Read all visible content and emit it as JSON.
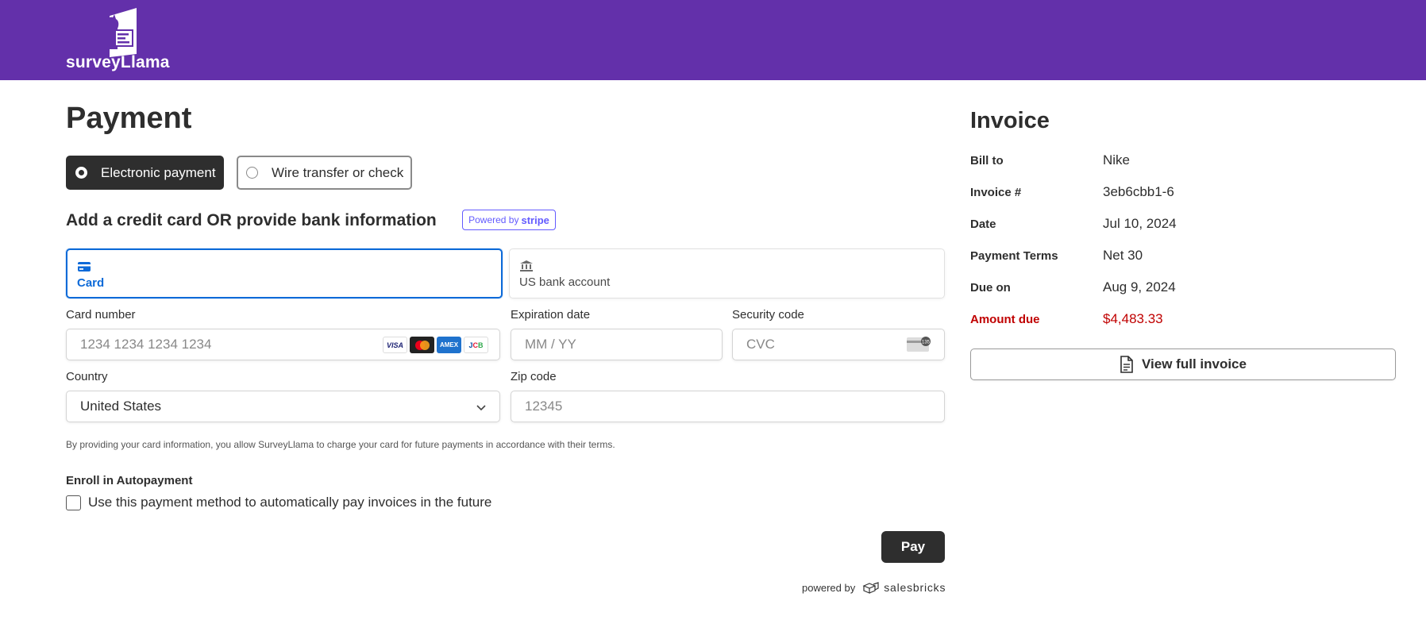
{
  "header": {
    "logo_text": "surveyLlama",
    "background": "#6330aa"
  },
  "payment": {
    "title": "Payment",
    "methods": {
      "electronic": "Electronic payment",
      "wire": "Wire transfer or check",
      "selected": "Electronic payment"
    },
    "section_title": "Add a credit card OR provide bank information",
    "stripe_badge": {
      "prefix": "Powered by",
      "brand": "stripe"
    },
    "tabs": {
      "card": "Card",
      "bank": "US bank account",
      "selected": "Card"
    },
    "form": {
      "card_number_label": "Card number",
      "card_number_placeholder": "1234 1234 1234 1234",
      "card_brands": [
        "VISA",
        "Mastercard",
        "AMEX",
        "JCB"
      ],
      "expiration_label": "Expiration date",
      "expiration_placeholder": "MM / YY",
      "security_label": "Security code",
      "security_placeholder": "CVC",
      "cvc_icon_text": "135",
      "country_label": "Country",
      "country_value": "United States",
      "zip_label": "Zip code",
      "zip_placeholder": "12345"
    },
    "disclaimer": "By providing your card information, you allow SurveyLlama to charge your card for future payments in accordance with their terms.",
    "autopay": {
      "title": "Enroll in Autopayment",
      "checkbox_label": "Use this payment method to automatically pay invoices in the future",
      "checked": false
    },
    "pay_button": "Pay",
    "powered_by": {
      "prefix": "powered by",
      "brand": "salesbricks"
    }
  },
  "invoice": {
    "title": "Invoice",
    "rows": [
      {
        "label": "Bill to",
        "value": "Nike"
      },
      {
        "label": "Invoice #",
        "value": "3eb6cbb1-6"
      },
      {
        "label": "Date",
        "value": "Jul 10, 2024"
      },
      {
        "label": "Payment Terms",
        "value": "Net 30"
      },
      {
        "label": "Due on",
        "value": "Aug 9, 2024"
      },
      {
        "label": "Amount due",
        "value": "$4,483.33"
      }
    ],
    "view_button": "View full invoice",
    "amount_due_color": "#c00000"
  },
  "colors": {
    "accent": "#0d6ad8",
    "stripe": "#635bff",
    "dark_button": "#2e2e2e"
  }
}
